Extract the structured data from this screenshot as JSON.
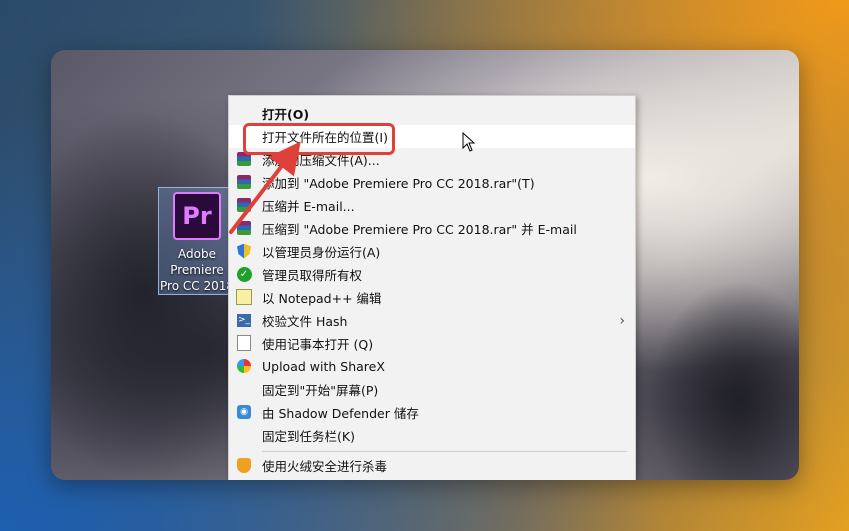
{
  "desktop_icon": {
    "logo_text": "Pr",
    "label_lines": [
      "Adobe",
      "Premiere",
      "Pro CC 2018"
    ]
  },
  "context_menu": {
    "items": [
      {
        "label": "打开(O)",
        "icon": "none",
        "bold": true
      },
      {
        "label": "打开文件所在的位置(I)",
        "icon": "none",
        "hover": true
      },
      {
        "label": "添加到压缩文件(A)...",
        "icon": "winrar-icon"
      },
      {
        "label": "添加到 \"Adobe Premiere Pro CC 2018.rar\"(T)",
        "icon": "winrar-icon"
      },
      {
        "label": "压缩并 E-mail...",
        "icon": "winrar-icon"
      },
      {
        "label": "压缩到 \"Adobe Premiere Pro CC 2018.rar\" 并 E-mail",
        "icon": "winrar-icon"
      },
      {
        "label": "以管理员身份运行(A)",
        "icon": "uac-shield-icon"
      },
      {
        "label": "管理员取得所有权",
        "icon": "green-shield-icon"
      },
      {
        "label": "以 Notepad++ 编辑",
        "icon": "notepad-icon"
      },
      {
        "label": "校验文件 Hash",
        "icon": "hash-icon",
        "submenu": true
      },
      {
        "label": "使用记事本打开 (Q)",
        "icon": "document-icon"
      },
      {
        "label": "Upload with ShareX",
        "icon": "sharex-icon"
      },
      {
        "label": "固定到\"开始\"屏幕(P)",
        "icon": "none"
      },
      {
        "label": "由 Shadow Defender 储存",
        "icon": "shadow-defender-icon"
      },
      {
        "label": "固定到任务栏(K)",
        "icon": "none"
      },
      {
        "label": "使用火绒安全进行杀毒",
        "icon": "huorong-icon"
      }
    ]
  },
  "colors": {
    "highlight_border": "#e0403a",
    "menu_background": "#f2f2f2",
    "premiere_purple": "#e07bff"
  }
}
